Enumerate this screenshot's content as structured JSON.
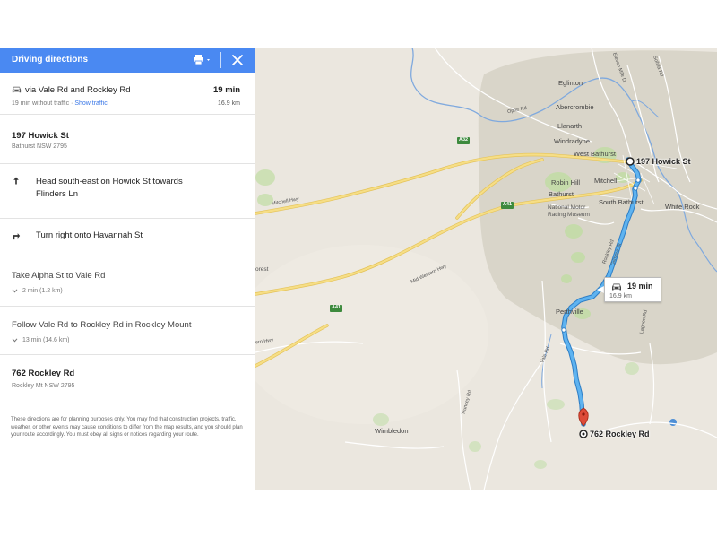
{
  "panel": {
    "title": "Driving directions",
    "summary": {
      "route_label": "via Vale Rd and Rockley Rd",
      "duration": "19 min",
      "without_traffic": "19 min without traffic",
      "separator": " · ",
      "show_traffic": "Show traffic",
      "distance": "16.9 km"
    },
    "origin": {
      "name": "197 Howick St",
      "locality": "Bathurst NSW 2795"
    },
    "steps": [
      {
        "text": "Head south-east on Howick St towards Flinders Ln",
        "icon": "arrow-up-icon"
      },
      {
        "text": "Turn right onto Havannah St",
        "icon": "turn-right-icon"
      }
    ],
    "groups": [
      {
        "title": "Take Alpha St to Vale Rd",
        "detail": "2 min (1.2 km)"
      },
      {
        "title": "Follow Vale Rd to Rockley Rd in Rockley Mount",
        "detail": "13 min (14.6 km)"
      }
    ],
    "destination": {
      "name": "762 Rockley Rd",
      "locality": "Rockley Mt NSW 2795"
    },
    "disclaimer": "These directions are for planning purposes only. You may find that construction projects, traffic, weather, or other events may cause conditions to differ from the map results, and you should plan your route accordingly. You must obey all signs or notices regarding your route."
  },
  "map": {
    "places": [
      "Eglinton",
      "Abercrombie",
      "Llanarth",
      "Windradyne",
      "West Bathurst",
      "Robin Hill",
      "Mitchell",
      "Bathurst",
      "South Bathurst",
      "National Motor",
      "Racing Museum",
      "White Rock",
      "Perthville",
      "Wimbledon",
      "orest"
    ],
    "road_labels": [
      "Ophir Rd",
      "Eleven Mile Dr",
      "Sofala Rd",
      "Gilmour St",
      "Mid Western Hwy",
      "Vale Rd",
      "Trunkey Rd",
      "Lagoon Rd",
      "Mitchell Hwy",
      "ern Hwy",
      "Rockley Rd"
    ],
    "shields": [
      "A32",
      "A41",
      "A41"
    ],
    "origin_label": "197 Howick St",
    "destination_label": "762 Rockley Rd",
    "route_callout": {
      "time": "19 min",
      "distance": "16.9 km"
    },
    "colors": {
      "route": "#4aa3e8",
      "route_outline": "#2f7fc6",
      "highway": "#f2d36a",
      "shaded_area": "#d7d3c6",
      "green": "#c8ddb0",
      "water": "#4e8fd6",
      "header": "#4a89f2",
      "pin": "#dd4b39"
    }
  }
}
